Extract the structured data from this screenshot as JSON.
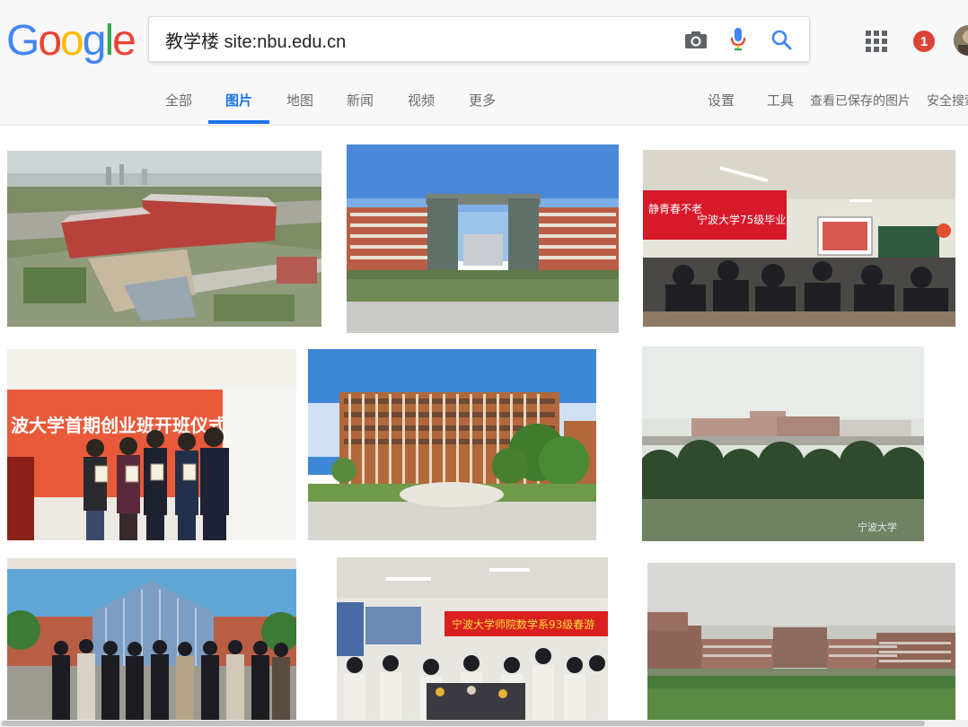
{
  "logo": {
    "letters": [
      "G",
      "o",
      "o",
      "g",
      "l",
      "e"
    ],
    "colors": [
      "#4285f4",
      "#ea4335",
      "#fbbc05",
      "#4285f4",
      "#34a853",
      "#ea4335"
    ]
  },
  "search": {
    "query": "教学楼 site:nbu.edu.cn"
  },
  "icons": {
    "camera": "camera-icon",
    "mic": "microphone-icon",
    "search": "search-icon",
    "apps": "apps-grid-icon"
  },
  "notifications": {
    "count": "1"
  },
  "tabs": [
    {
      "label": "全部",
      "active": false
    },
    {
      "label": "图片",
      "active": true
    },
    {
      "label": "地图",
      "active": false
    },
    {
      "label": "新闻",
      "active": false
    },
    {
      "label": "视频",
      "active": false
    },
    {
      "label": "更多",
      "active": false
    }
  ],
  "tools": {
    "settings": "设置",
    "tools": "工具",
    "saved": "查看已保存的图片",
    "safesearch": "安全搜索"
  },
  "images": {
    "img1": {
      "banner_left": "",
      "banner_right": ""
    },
    "img2": {},
    "img3": {
      "banner": "宁波大学75级毕业"
    },
    "img4": {
      "banner": "波大学首期创业班开班仪式"
    },
    "img5": {
      "stone": ""
    },
    "img6": {
      "watermark": "宁波大学"
    },
    "img7": {},
    "img8": {
      "banner": "宁波大学师院数学系93级春游"
    },
    "img9": {}
  },
  "colors": {
    "accent": "#1a73e8",
    "notif": "#db4437"
  }
}
